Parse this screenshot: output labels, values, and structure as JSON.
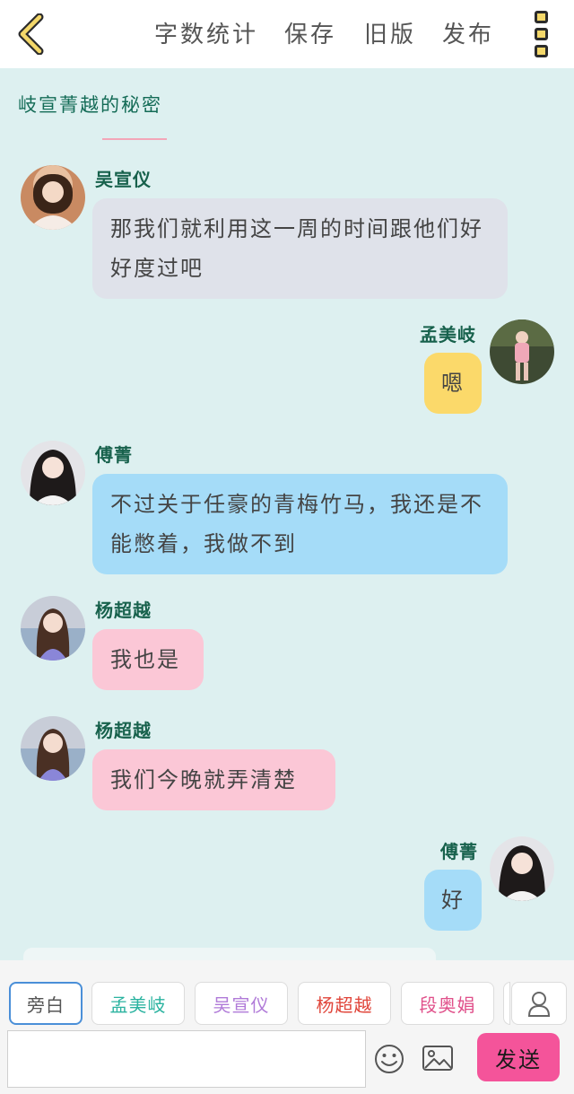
{
  "header": {
    "back_icon": "chevron-left-icon",
    "nav": [
      {
        "label": "字数统计"
      },
      {
        "label": "保存"
      },
      {
        "label": "旧版"
      },
      {
        "label": "发布"
      }
    ],
    "more_icon": "menu-dots-icon"
  },
  "story": {
    "title": "岐宣菁越的秘密"
  },
  "messages": [
    {
      "speaker": "吴宣仪",
      "side": "left",
      "text": "那我们就利用这一周的时间跟他们好好度过吧",
      "color": "#dfe2ea"
    },
    {
      "speaker": "孟美岐",
      "side": "right",
      "text": "嗯",
      "color": "#fbd96a"
    },
    {
      "speaker": "傅菁",
      "side": "left",
      "text": "不过关于任豪的青梅竹马，我还是不能憋着，我做不到",
      "color": "#a5dcf8"
    },
    {
      "speaker": "杨超越",
      "side": "left",
      "text": "我也是",
      "color": "#fbc7d6"
    },
    {
      "speaker": "杨超越",
      "side": "left",
      "text": "我们今晚就弄清楚",
      "color": "#fbc7d6"
    },
    {
      "speaker": "傅菁",
      "side": "right",
      "text": "好",
      "color": "#a5dcf8"
    }
  ],
  "characters": [
    {
      "label": "旁白",
      "color": "#555555"
    },
    {
      "label": "孟美岐",
      "color": "#2bb3a0"
    },
    {
      "label": "吴宣仪",
      "color": "#b07ad8"
    },
    {
      "label": "杨超越",
      "color": "#e0453a"
    },
    {
      "label": "段奥娟",
      "color": "#e0508a"
    }
  ],
  "composer": {
    "input_value": "",
    "emoji_icon": "smiley-icon",
    "image_icon": "image-icon",
    "person_icon": "person-icon",
    "send_label": "发送",
    "send_color": "#f4549a"
  }
}
